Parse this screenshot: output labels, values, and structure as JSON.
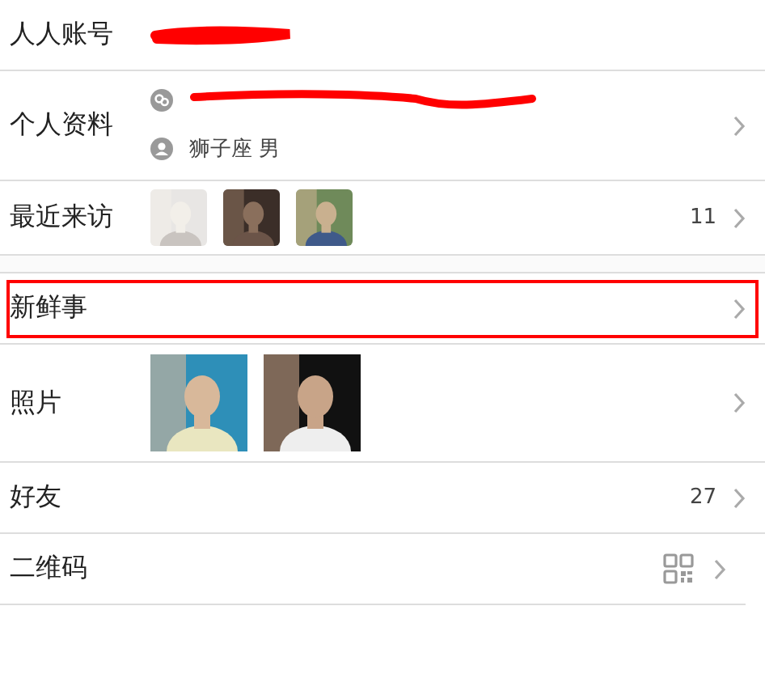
{
  "rows": [
    {
      "kind": "account",
      "label": "人人账号",
      "redacted": true
    },
    {
      "kind": "profile",
      "label": "个人资料",
      "lines": [
        {
          "redacted": true
        },
        {
          "text": "狮子座 男"
        }
      ],
      "chevron": true
    },
    {
      "kind": "visitors",
      "label": "最近来访",
      "count": "11",
      "chevron": true,
      "gap_after": true
    },
    {
      "kind": "plain",
      "label": "新鲜事",
      "highlighted": true,
      "chevron": true
    },
    {
      "kind": "photos",
      "label": "照片",
      "chevron": true
    },
    {
      "kind": "plain",
      "label": "好友",
      "count": "27",
      "chevron": true
    },
    {
      "kind": "qr",
      "label": "二维码",
      "chevron": true
    }
  ]
}
